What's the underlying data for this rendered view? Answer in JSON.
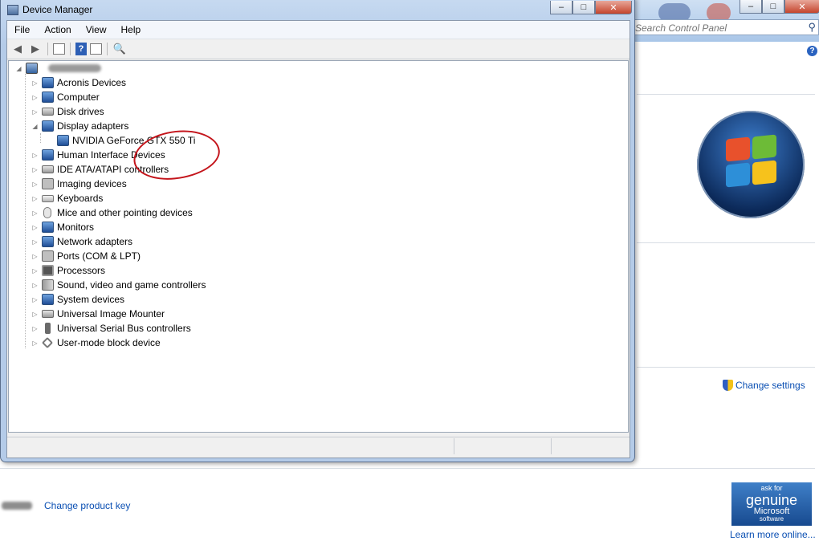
{
  "control_panel": {
    "search_placeholder": "Search Control Panel",
    "help_icon": "?",
    "change_settings": "Change settings",
    "change_product_key": "Change product key",
    "genuine_badge": {
      "line1": "ask for",
      "line2": "genuine",
      "line3": "Microsoft",
      "line4": "software"
    },
    "learn_more": "Learn more online..."
  },
  "window": {
    "title": "Device Manager",
    "controls": {
      "minimize": "–",
      "maximize": "□",
      "close": "✕"
    }
  },
  "menu": [
    "File",
    "Action",
    "View",
    "Help"
  ],
  "toolbar_icons": [
    "back-arrow-icon",
    "forward-arrow-icon",
    "properties-icon",
    "help-icon",
    "view-icon",
    "scan-hardware-icon"
  ],
  "tree": {
    "root_label": "",
    "categories": [
      {
        "label": "Acronis Devices",
        "icon": "device-icon"
      },
      {
        "label": "Computer",
        "icon": "computer-icon"
      },
      {
        "label": "Disk drives",
        "icon": "disk-icon"
      },
      {
        "label": "Display adapters",
        "icon": "display-icon",
        "expanded": true,
        "children": [
          "NVIDIA GeForce GTX 550 Ti"
        ]
      },
      {
        "label": "Human Interface Devices",
        "icon": "hid-icon"
      },
      {
        "label": "IDE ATA/ATAPI controllers",
        "icon": "ide-icon"
      },
      {
        "label": "Imaging devices",
        "icon": "camera-icon"
      },
      {
        "label": "Keyboards",
        "icon": "keyboard-icon"
      },
      {
        "label": "Mice and other pointing devices",
        "icon": "mouse-icon"
      },
      {
        "label": "Monitors",
        "icon": "monitor-icon"
      },
      {
        "label": "Network adapters",
        "icon": "network-icon"
      },
      {
        "label": "Ports (COM & LPT)",
        "icon": "port-icon"
      },
      {
        "label": "Processors",
        "icon": "processor-icon"
      },
      {
        "label": "Sound, video and game controllers",
        "icon": "speaker-icon"
      },
      {
        "label": "System devices",
        "icon": "system-icon"
      },
      {
        "label": "Universal Image Mounter",
        "icon": "mounter-icon"
      },
      {
        "label": "Universal Serial Bus controllers",
        "icon": "usb-icon"
      },
      {
        "label": "User-mode block device",
        "icon": "block-device-icon"
      }
    ]
  },
  "colors": {
    "annotation_circle": "#c4151c",
    "link": "#0a4fb3"
  }
}
